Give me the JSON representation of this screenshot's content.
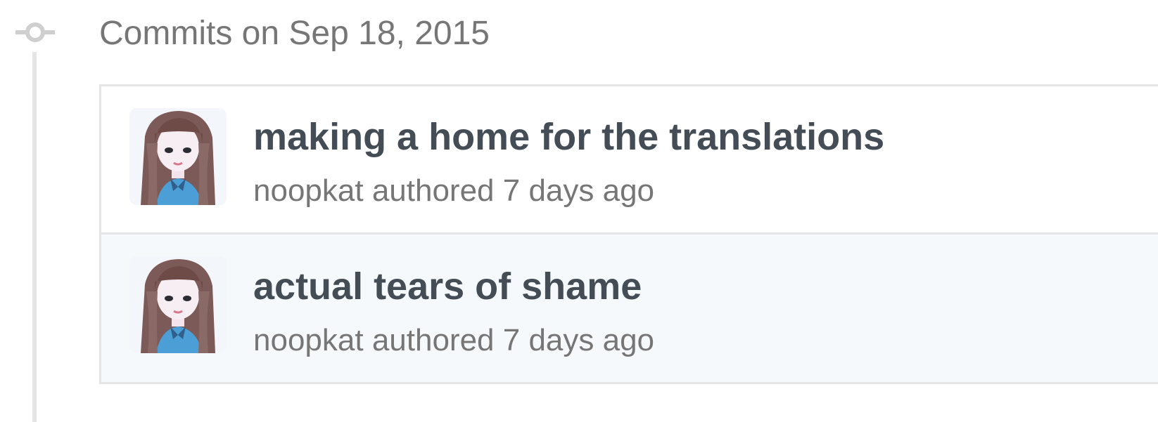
{
  "group": {
    "header": "Commits on Sep 18, 2015",
    "icon": "git-commit-icon"
  },
  "colors": {
    "timeline": "#e5e5e5",
    "title": "#444d56",
    "meta": "#767676",
    "row_alt_bg": "#f6f9fb",
    "border": "#e5e5e5"
  },
  "commits": [
    {
      "title": "making a home for the translations",
      "author": "noopkat",
      "action": "authored",
      "time": "7 days ago",
      "avatar_icon": "user-avatar"
    },
    {
      "title": "actual tears of shame",
      "author": "noopkat",
      "action": "authored",
      "time": "7 days ago",
      "avatar_icon": "user-avatar"
    }
  ]
}
